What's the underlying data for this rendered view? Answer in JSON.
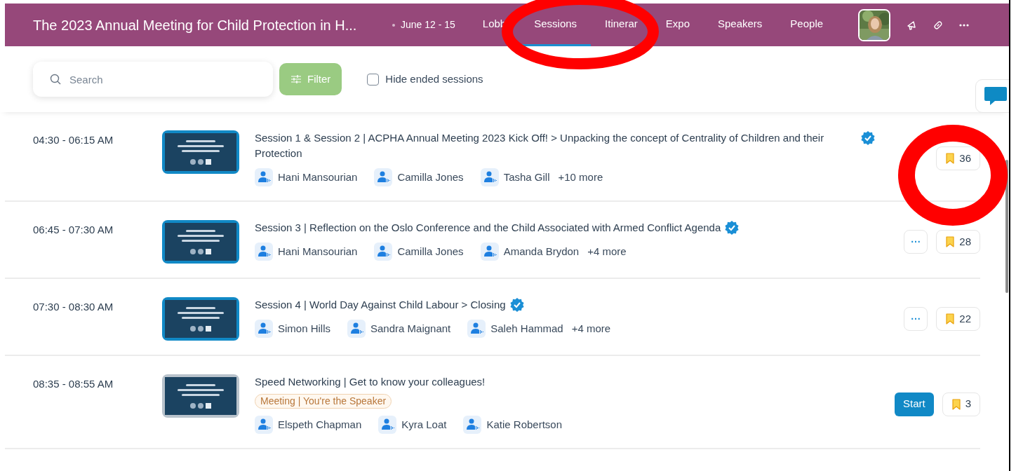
{
  "header": {
    "title": "The 2023 Annual Meeting for Child Protection in H...",
    "dates": "June 12 - 15",
    "tabs": [
      {
        "label": "Lobb",
        "selected": false
      },
      {
        "label": "Sessions",
        "selected": true
      },
      {
        "label": "Itinerar",
        "selected": false
      },
      {
        "label": "Expo",
        "selected": false
      },
      {
        "label": "Speakers",
        "selected": false
      },
      {
        "label": "People",
        "selected": false
      }
    ]
  },
  "toolbar": {
    "search": {
      "placeholder": "Search"
    },
    "filter_button": "Filter",
    "hide_ended": {
      "label": "Hide ended sessions",
      "checked": false
    }
  },
  "sessions": [
    {
      "time": "04:30 - 06:15 AM",
      "color": "#1189c6",
      "title": "Session 1 & Session 2 | ACPHA Annual Meeting 2023 Kick Off! > Unpacking the concept of Centrality of Children and their Protection",
      "verified": true,
      "speakers": [
        "Hani Mansourian",
        "Camilla Jones",
        "Tasha Gill"
      ],
      "more": "+10 more",
      "bookmarks": "36"
    },
    {
      "time": "06:45 - 07:30 AM",
      "color": "#1189c6",
      "title": "Session 3 | Reflection on the Oslo Conference and the Child Associated with Armed Conflict Agenda",
      "verified": true,
      "speakers": [
        "Hani Mansourian",
        "Camilla Jones",
        "Amanda Brydon"
      ],
      "more": "+4 more",
      "action": {
        "kind": "menu",
        "label": "···"
      },
      "bookmarks": "28"
    },
    {
      "time": "07:30 - 08:30 AM",
      "color": "#1189c6",
      "title": "Session 4 | World Day Against Child Labour > Closing",
      "verified": true,
      "speakers": [
        "Simon Hills",
        "Sandra Maignant",
        "Saleh Hammad"
      ],
      "more": "+4 more",
      "action": {
        "kind": "menu",
        "label": "···"
      },
      "bookmarks": "22"
    },
    {
      "time": "08:35 - 08:55 AM",
      "color": "#b9c3cc",
      "title": "Speed Networking | Get to know your colleagues!",
      "verified": false,
      "tag": "Meeting | You're the Speaker",
      "speakers": [
        "Elspeth Chapman",
        "Kyra Loat",
        "Katie Robertson"
      ],
      "action": {
        "kind": "start",
        "label": "Start"
      },
      "bookmarks": "3"
    }
  ]
}
